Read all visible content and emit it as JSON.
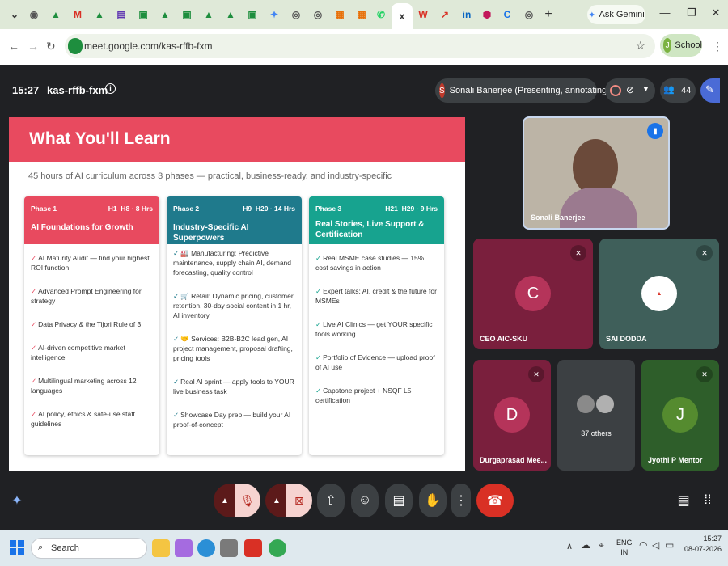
{
  "browser": {
    "ask_gemini": "Ask Gemini",
    "url": "meet.google.com/kas-rffb-fxm",
    "profile_label": "School",
    "profile_initial": "J",
    "tab_close": "x",
    "new_tab": "+"
  },
  "meet": {
    "time": "15:27",
    "code": "kas-rffb-fxm",
    "presenter_initial": "S",
    "presenter_label": "Sonali Banerjee (Presenting, annotating)",
    "participant_count": "44"
  },
  "slide": {
    "title": "What You'll Learn",
    "subtitle": "45 hours of AI curriculum across 3 phases — practical, business-ready, and industry-specific",
    "phases": [
      {
        "tag": "Phase 1",
        "range": "H1–H8 · 8 Hrs",
        "name": "AI Foundations for Growth",
        "color": "#e84a5f",
        "items": [
          "AI Maturity Audit — find your highest ROI function",
          "Advanced Prompt Engineering for strategy",
          "Data Privacy & the Tijori Rule of 3",
          "AI-driven competitive market intelligence",
          "Multilingual marketing across 12 languages",
          "AI policy, ethics & safe-use staff guidelines"
        ]
      },
      {
        "tag": "Phase 2",
        "range": "H9–H20 · 14 Hrs",
        "name": "Industry-Specific AI Superpowers",
        "color": "#1f7a8c",
        "items": [
          "🏭 Manufacturing: Predictive maintenance, supply chain AI, demand forecasting, quality control",
          "🛒 Retail: Dynamic pricing, customer retention, 30-day social content in 1 hr, AI inventory",
          "🤝 Services: B2B-B2C lead gen, AI project management, proposal drafting, pricing tools",
          "Real AI sprint — apply tools to YOUR live business task",
          "Showcase Day prep — build your AI proof-of-concept"
        ]
      },
      {
        "tag": "Phase 3",
        "range": "H21–H29 · 9 Hrs",
        "name": "Real Stories, Live Support & Certification",
        "color": "#17a38f",
        "items": [
          "Real MSME case studies — 15% cost savings in action",
          "Expert talks: AI, credit & the future for MSMEs",
          "Live AI Clinics — get YOUR specific tools working",
          "Portfolio of Evidence — upload proof of AI use",
          "Capstone project + NSQF L5 certification"
        ]
      }
    ]
  },
  "participants": {
    "self_name": "Sonali Banerjee",
    "tiles": [
      {
        "name": "CEO AIC-SKU",
        "initial": "C",
        "bg": "#7a1f3d",
        "av": "#b5345a"
      },
      {
        "name": "SAI DODDA",
        "initial": "",
        "bg": "#3f5f5a",
        "av": "#ffffff"
      },
      {
        "name": "Durgaprasad Mee...",
        "initial": "D",
        "bg": "#7a1f3d",
        "av": "#b5345a"
      },
      {
        "name": "37 others",
        "initial": "",
        "bg": "#3c4043",
        "av": "#888888"
      },
      {
        "name": "Jyothi P Mentor",
        "initial": "J",
        "bg": "#2e5e2a",
        "av": "#558b2f"
      }
    ]
  },
  "taskbar": {
    "search_label": "Search",
    "lang_top": "ENG",
    "lang_bottom": "IN",
    "clock_time": "15:27",
    "clock_date": "08-07-2026"
  }
}
